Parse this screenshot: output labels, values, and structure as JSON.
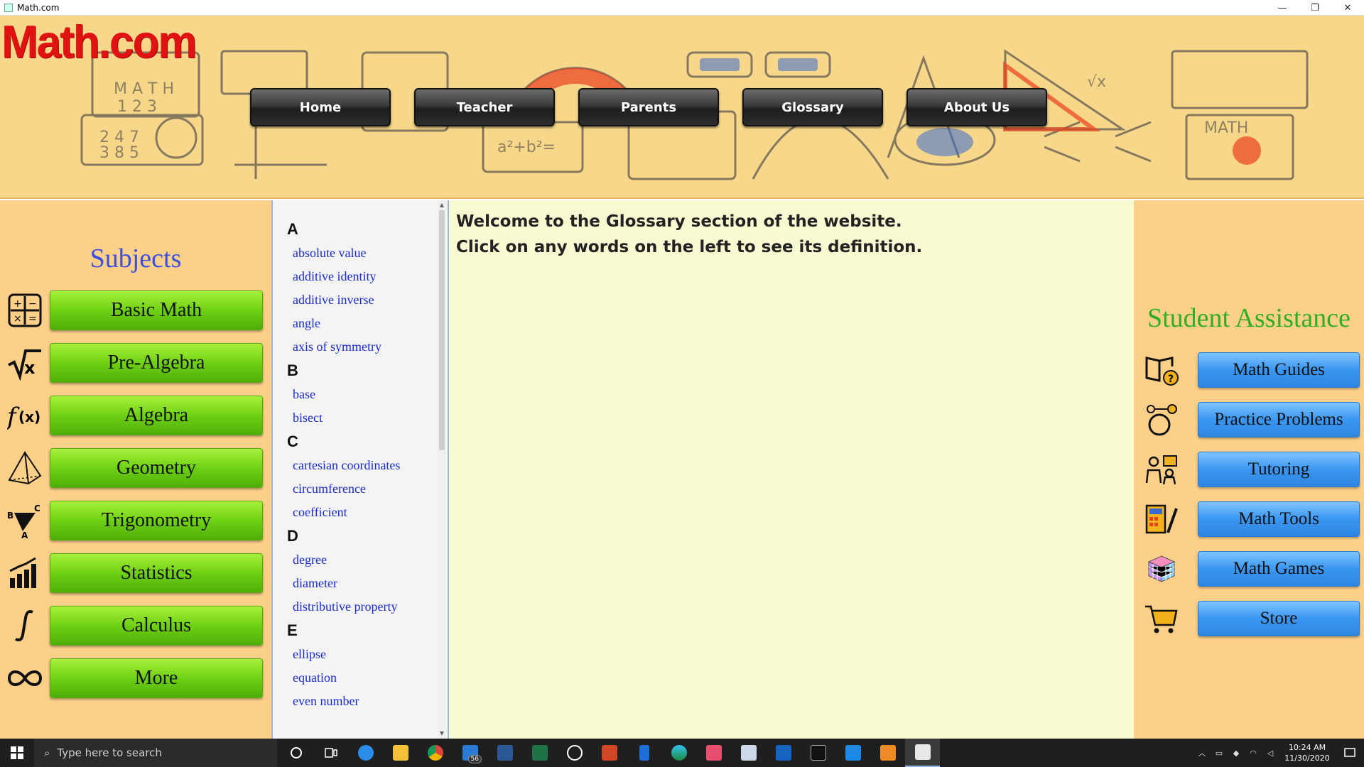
{
  "window": {
    "title": "Math.com",
    "minimize": "—",
    "maximize": "❐",
    "close": "✕"
  },
  "banner": {
    "logo": "Math.com"
  },
  "nav": {
    "items": [
      {
        "label": "Home"
      },
      {
        "label": "Teacher"
      },
      {
        "label": "Parents"
      },
      {
        "label": "Glossary"
      },
      {
        "label": "About Us"
      }
    ]
  },
  "subjects": {
    "title": "Subjects",
    "items": [
      {
        "label": "Basic Math",
        "icon": "calculator-icon"
      },
      {
        "label": "Pre-Algebra",
        "icon": "square-root-icon"
      },
      {
        "label": "Algebra",
        "icon": "function-icon"
      },
      {
        "label": "Geometry",
        "icon": "pyramid-icon"
      },
      {
        "label": "Trigonometry",
        "icon": "triangle-icon"
      },
      {
        "label": "Statistics",
        "icon": "bar-chart-icon"
      },
      {
        "label": "Calculus",
        "icon": "integral-icon"
      },
      {
        "label": "More",
        "icon": "infinity-icon"
      }
    ]
  },
  "glossary": {
    "sections": [
      {
        "letter": "A",
        "words": [
          "absolute value",
          "additive identity",
          "additive inverse",
          "angle",
          "axis of symmetry"
        ]
      },
      {
        "letter": "B",
        "words": [
          "base",
          "bisect"
        ]
      },
      {
        "letter": "C",
        "words": [
          "cartesian coordinates",
          "circumference",
          "coefficient"
        ]
      },
      {
        "letter": "D",
        "words": [
          "degree",
          "diameter",
          "distributive property"
        ]
      },
      {
        "letter": "E",
        "words": [
          "ellipse",
          "equation",
          "even number"
        ]
      }
    ]
  },
  "definition": {
    "line1": "Welcome to the Glossary section of the website.",
    "line2": "Click on any words on the left to see its definition."
  },
  "assistance": {
    "title": "Student Assistance",
    "items": [
      {
        "label": "Math Guides",
        "icon": "book-question-icon"
      },
      {
        "label": "Practice Problems",
        "icon": "thinking-head-icon"
      },
      {
        "label": "Tutoring",
        "icon": "tutor-icon"
      },
      {
        "label": "Math Tools",
        "icon": "calculator-ruler-icon"
      },
      {
        "label": "Math Games",
        "icon": "rubiks-cube-icon"
      },
      {
        "label": "Store",
        "icon": "shopping-cart-icon"
      }
    ]
  },
  "taskbar": {
    "search_placeholder": "Type here to search",
    "mail_badge": "56",
    "time": "10:24 AM",
    "date": "11/30/2020"
  },
  "colors": {
    "accent_green": "#6fd114",
    "accent_blue": "#3a96f0",
    "logo_red": "#e01212",
    "panel_orange": "#fdd08a"
  }
}
